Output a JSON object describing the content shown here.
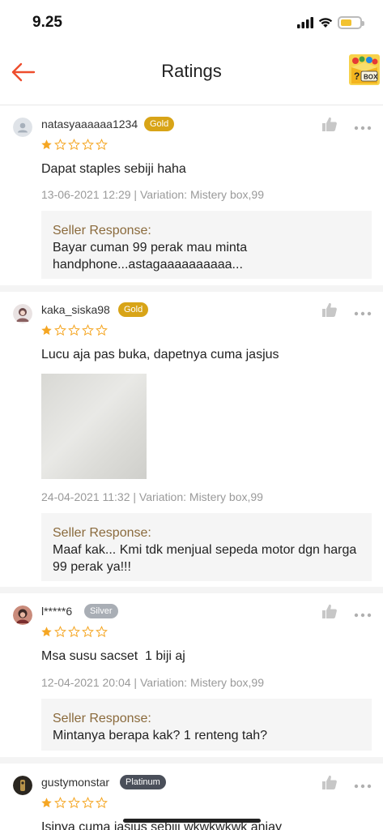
{
  "status": {
    "time": "9.25"
  },
  "nav": {
    "title": "Ratings"
  },
  "reviews": [
    {
      "username": "natasyaaaaaa1234",
      "badge": "Gold",
      "badge_color": "#d8a417",
      "rating": 1,
      "text": "Dapat staples sebiji haha",
      "meta": "13-06-2021 12:29 | Variation: Mistery box,99",
      "response_label": "Seller Response:",
      "response_text": "Bayar cuman 99 perak mau minta handphone...astagaaaaaaaaaa..."
    },
    {
      "username": "kaka_siska98",
      "badge": "Gold",
      "badge_color": "#d8a417",
      "rating": 1,
      "text": "Lucu aja pas buka, dapetnya cuma jasjus",
      "meta": "24-04-2021 11:32 | Variation: Mistery box,99",
      "response_label": "Seller Response:",
      "response_text": "Maaf kak... Kmi tdk menjual sepeda motor dgn harga 99 perak ya!!!"
    },
    {
      "username": "l*****6",
      "badge": "Silver",
      "badge_color": "#a9aeb5",
      "rating": 1,
      "text": "Msa susu sacset  1 biji aj",
      "meta": "12-04-2021 20:04 | Variation: Mistery box,99",
      "response_label": "Seller Response:",
      "response_text": "Mintanya berapa kak? 1 renteng tah?"
    },
    {
      "username": "gustymonstar",
      "badge": "Platinum",
      "badge_color": "#4a4f5a",
      "rating": 1,
      "text": "Isinya cuma jasjus sebiji wkwkwkwk anjay"
    }
  ],
  "colors": {
    "accent": "#ee4d2d",
    "star": "#f5a623",
    "response_label": "#8a6a3c"
  },
  "icons": {
    "back": "arrow-left-icon",
    "like": "thumbs-up-icon",
    "more": "more-dots-icon"
  }
}
